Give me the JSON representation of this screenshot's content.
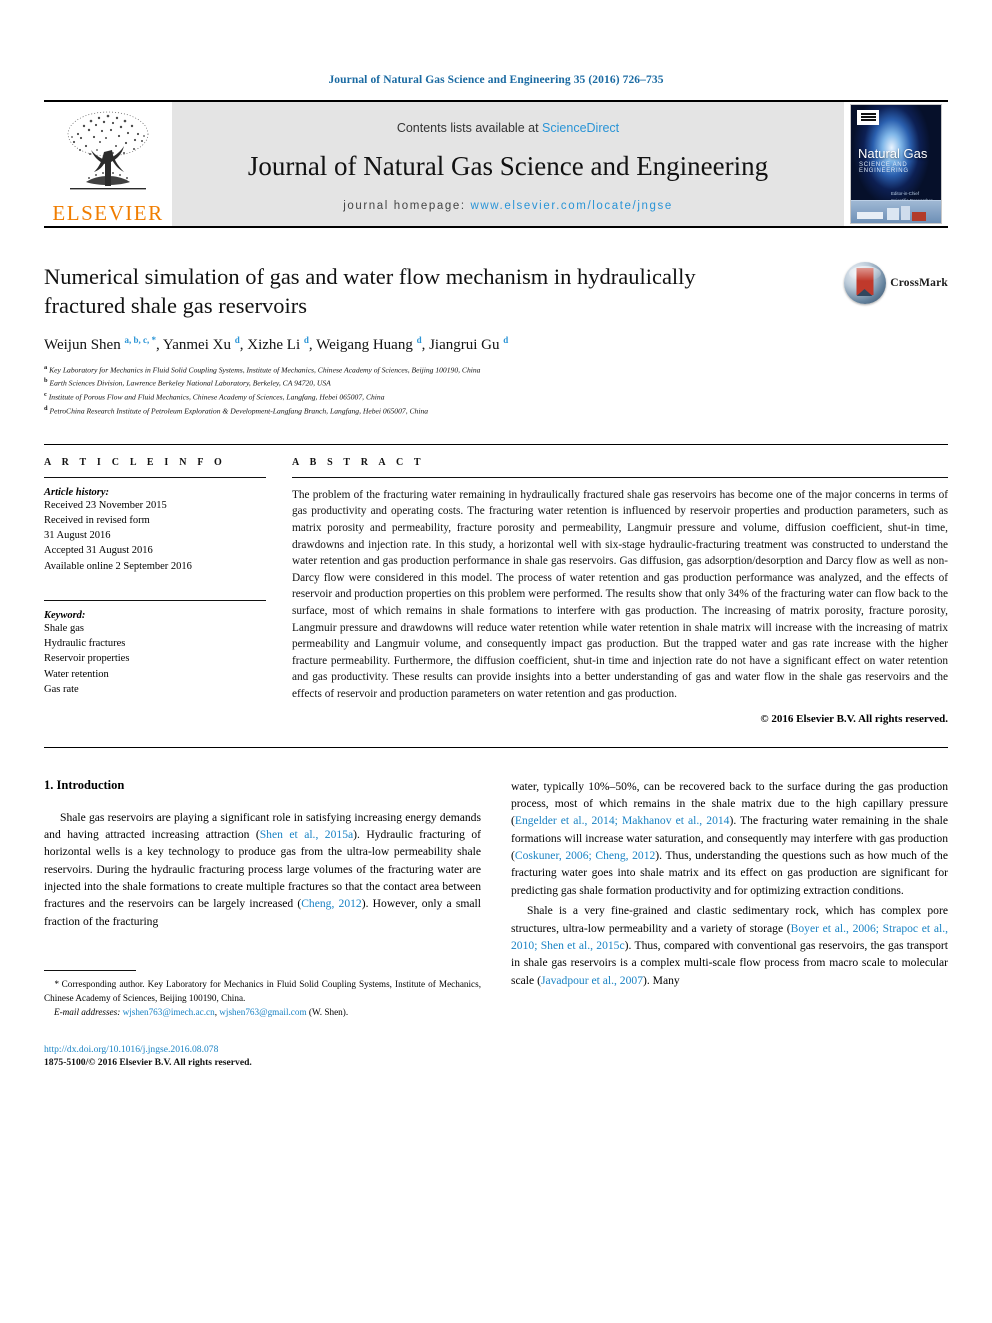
{
  "running_head": "Journal of Natural Gas Science and Engineering 35 (2016) 726–735",
  "masthead": {
    "publisher_wordmark": "ELSEVIER",
    "contents_prefix": "Contents lists available at",
    "contents_link": "ScienceDirect",
    "journal_title": "Journal of Natural Gas Science and Engineering",
    "homepage_label": "journal homepage:",
    "homepage_link": "www.elsevier.com/locate/jngse",
    "cover": {
      "title": "Natural Gas",
      "subtitle": "SCIENCE AND ENGINEERING",
      "editors": "Editor-in-Chief\nScientific Researcher"
    }
  },
  "article": {
    "title": "Numerical simulation of gas and water flow mechanism in hydraulically fractured shale gas reservoirs",
    "authors_html": "Weijun Shen <sup>a, b, c, *</sup>, Yanmei Xu <sup>d</sup>, Xizhe Li <sup>d</sup>, Weigang Huang <sup>d</sup>, Jiangrui Gu <sup>d</sup>",
    "affiliations": [
      {
        "mark": "a",
        "text": "Key Laboratory for Mechanics in Fluid Solid Coupling Systems, Institute of Mechanics, Chinese Academy of Sciences, Beijing 100190, China"
      },
      {
        "mark": "b",
        "text": "Earth Sciences Division, Lawrence Berkeley National Laboratory, Berkeley, CA 94720, USA"
      },
      {
        "mark": "c",
        "text": "Institute of Porous Flow and Fluid Mechanics, Chinese Academy of Sciences, Langfang, Hebei 065007, China"
      },
      {
        "mark": "d",
        "text": "PetroChina Research Institute of Petroleum Exploration & Development-Langfang Branch, Langfang, Hebei 065007, China"
      }
    ],
    "crossmark_label": "CrossMark"
  },
  "article_info": {
    "heading": "A R T I C L E   I N F O",
    "history_label": "Article history:",
    "history": [
      "Received 23 November 2015",
      "Received in revised form",
      "31 August 2016",
      "Accepted 31 August 2016",
      "Available online 2 September 2016"
    ],
    "keyword_label": "Keyword:",
    "keywords": [
      "Shale gas",
      "Hydraulic fractures",
      "Reservoir properties",
      "Water retention",
      "Gas rate"
    ]
  },
  "abstract": {
    "heading": "A B S T R A C T",
    "text": "The problem of the fracturing water remaining in hydraulically fractured shale gas reservoirs has become one of the major concerns in terms of gas productivity and operating costs. The fracturing water retention is influenced by reservoir properties and production parameters, such as matrix porosity and permeability, fracture porosity and permeability, Langmuir pressure and volume, diffusion coefficient, shut-in time, drawdowns and injection rate. In this study, a horizontal well with six-stage hydraulic-fracturing treatment was constructed to understand the water retention and gas production performance in shale gas reservoirs. Gas diffusion, gas adsorption/desorption and Darcy flow as well as non-Darcy flow were considered in this model. The process of water retention and gas production performance was analyzed, and the effects of reservoir and production properties on this problem were performed. The results show that only 34% of the fracturing water can flow back to the surface, most of which remains in shale formations to interfere with gas production. The increasing of matrix porosity, fracture porosity, Langmuir pressure and drawdowns will reduce water retention while water retention in shale matrix will increase with the increasing of matrix permeability and Langmuir volume, and consequently impact gas production. But the trapped water and gas rate increase with the higher fracture permeability. Furthermore, the diffusion coefficient, shut-in time and injection rate do not have a significant effect on water retention and gas productivity. These results can provide insights into a better understanding of gas and water flow in the shale gas reservoirs and the effects of reservoir and production parameters on water retention and gas production.",
    "copyright": "© 2016 Elsevier B.V. All rights reserved."
  },
  "introduction": {
    "heading": "1. Introduction",
    "left_para_1_html": "Shale gas reservoirs are playing a significant role in satisfying increasing energy demands and having attracted increasing attraction (<span class=\"ref\">Shen et al., 2015a</span>). Hydraulic fracturing of horizontal wells is a key technology to produce gas from the ultra-low permeability shale reservoirs. During the hydraulic fracturing process large volumes of the fracturing water are injected into the shale formations to create multiple fractures so that the contact area between fractures and the reservoirs can be largely increased (<span class=\"ref\">Cheng, 2012</span>). However, only a small fraction of the fracturing",
    "right_para_1_html": "water, typically 10%&ndash;50%, can be recovered back to the surface during the gas production process, most of which remains in the shale matrix due to the high capillary pressure (<span class=\"ref\">Engelder et al., 2014; Makhanov et al., 2014</span>). The fracturing water remaining in the shale formations will increase water saturation, and consequently may interfere with gas production (<span class=\"ref\">Coskuner, 2006; Cheng, 2012</span>). Thus, understanding the questions such as how much of the fracturing water goes into shale matrix and its effect on gas production are significant for predicting gas shale formation productivity and for optimizing extraction conditions.",
    "right_para_2_html": "Shale is a very fine-grained and clastic sedimentary rock, which has complex pore structures, ultra-low permeability and a variety of storage (<span class=\"ref\">Boyer et al., 2006; Strapoc et al., 2010; Shen et al., 2015c</span>). Thus, compared with conventional gas reservoirs, the gas transport in shale gas reservoirs is a complex multi-scale flow process from macro scale to molecular scale (<span class=\"ref\">Javadpour et al., 2007</span>). Many"
  },
  "footnote": {
    "corresponding_html": "<span class=\"lab\">*</span> Corresponding author. Key Laboratory for Mechanics in Fluid Solid Coupling Systems, Institute of Mechanics, Chinese Academy of Sciences, Beijing 100190, China.",
    "email_html": "<span class=\"lab\">E-mail addresses:</span> <span class=\"ref\">wjshen763@imech.ac.cn</span>, <span class=\"ref\">wjshen763@gmail.com</span> (W. Shen)."
  },
  "footer": {
    "doi": "http://dx.doi.org/10.1016/j.jngse.2016.08.078",
    "issn": "1875-5100/© 2016 Elsevier B.V. All rights reserved."
  },
  "colors": {
    "link_blue": "#1a83c4",
    "header_blue": "#1a6aa2",
    "elsevier_orange": "#f07d00",
    "banner_grey": "#e4e4e4"
  }
}
